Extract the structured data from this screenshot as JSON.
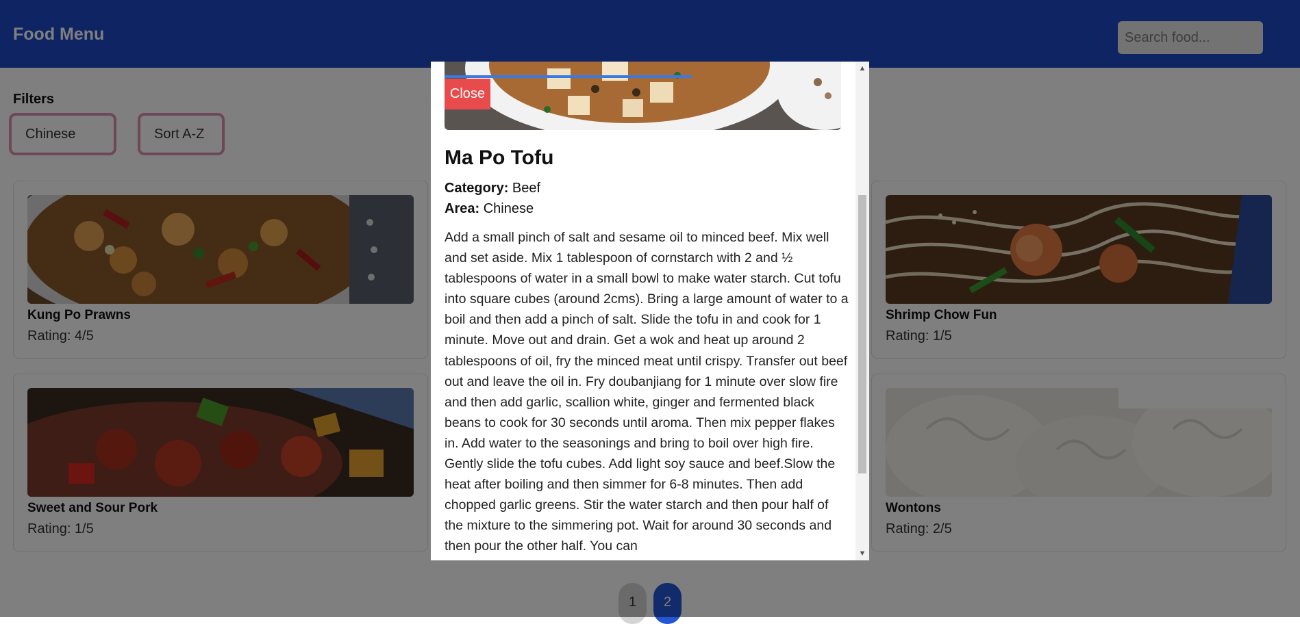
{
  "header": {
    "title": "Food Menu",
    "search_placeholder": "Search food..."
  },
  "filters": {
    "title": "Filters",
    "area_value": "Chinese",
    "sort_label": "Sort A-Z"
  },
  "cards": [
    {
      "name": "Kung Po Prawns",
      "rating": "Rating: 4/5"
    },
    {
      "name": "Shrimp Chow Fun",
      "rating": "Rating: 1/5"
    },
    {
      "name": "Sweet and Sour Pork",
      "rating": "Rating: 1/5"
    },
    {
      "name": "Wontons",
      "rating": "Rating: 2/5"
    }
  ],
  "pagination": {
    "pages": [
      "1",
      "2"
    ],
    "current": "2"
  },
  "modal": {
    "close_label": "Close",
    "title": "Ma Po Tofu",
    "category_label": "Category:",
    "category_value": " Beef",
    "area_label": "Area:",
    "area_value": " Chinese",
    "instructions": "Add a small pinch of salt and sesame oil to minced beef. Mix well and set aside. Mix 1 tablespoon of cornstarch with 2 and ½ tablespoons of water in a small bowl to make water starch. Cut tofu into square cubes (around 2cms). Bring a large amount of water to a boil and then add a pinch of salt. Slide the tofu in and cook for 1 minute. Move out and drain. Get a wok and heat up around 2 tablespoons of oil, fry the minced meat until crispy. Transfer out beef out and leave the oil in. Fry doubanjiang for 1 minute over slow fire and then add garlic, scallion white, ginger and fermented black beans to cook for 30 seconds until aroma. Then mix pepper flakes in. Add water to the seasonings and bring to boil over high fire. Gently slide the tofu cubes. Add light soy sauce and beef.Slow the heat after boiling and then simmer for 6-8 minutes. Then add chopped garlic greens. Stir the water starch and then pour half of the mixture to the simmering pot. Wait for around 30 seconds and then pour the other half. You can"
  },
  "colors": {
    "header": "#1e48c4",
    "filter_border": "#dc8fb0",
    "close_button": "#e84b4b",
    "active_page": "#2456d4"
  }
}
